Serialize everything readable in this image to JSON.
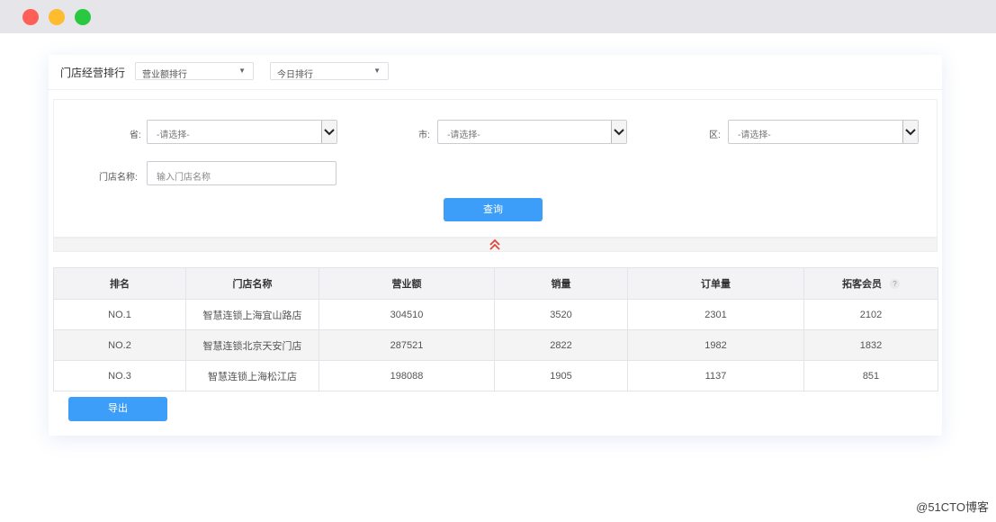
{
  "window": {
    "controls": [
      "close",
      "minimize",
      "maximize"
    ],
    "traffic_colors": {
      "close": "#fe5f57",
      "minimize": "#febc2e",
      "maximize": "#28c840"
    }
  },
  "header": {
    "title": "门店经营排行",
    "sort_select": {
      "value": "营业额排行"
    },
    "period_select": {
      "value": "今日排行"
    }
  },
  "filters": {
    "province": {
      "label": "省:",
      "value": "-请选择-"
    },
    "city": {
      "label": "市:",
      "value": "-请选择-"
    },
    "district": {
      "label": "区:",
      "value": "-请选择-"
    },
    "store_name": {
      "label": "门店名称:",
      "placeholder": "输入门店名称"
    },
    "query_button": "查询"
  },
  "collapse_icon": "double-chevron-up-icon",
  "table": {
    "headers": [
      "排名",
      "门店名称",
      "营业额",
      "销量",
      "订单量",
      "拓客会员"
    ],
    "rows": [
      [
        "NO.1",
        "智慧连锁上海宜山路店",
        "304510",
        "3520",
        "2301",
        "2102"
      ],
      [
        "NO.2",
        "智慧连锁北京天安门店",
        "287521",
        "2822",
        "1982",
        "1832"
      ],
      [
        "NO.3",
        "智慧连锁上海松江店",
        "198088",
        "1905",
        "1137",
        "851"
      ]
    ]
  },
  "export_button": "导出",
  "accent_color": "#3c9ef9",
  "watermark": "@51CTO博客"
}
